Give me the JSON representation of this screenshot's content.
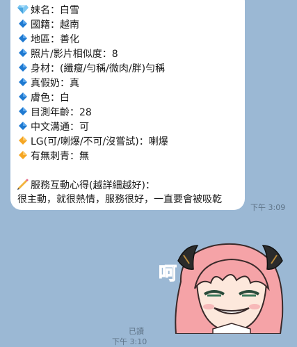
{
  "message": {
    "lines": [
      {
        "icon": "gem",
        "text": "妹名：白雪"
      },
      {
        "icon": "blue-diamond",
        "text": "國籍：越南"
      },
      {
        "icon": "blue-diamond",
        "text": "地區：善化"
      },
      {
        "icon": "blue-diamond",
        "text": "照片/影片相似度：8"
      },
      {
        "icon": "blue-diamond",
        "text": "身材：(纖瘦/勻稱/微肉/胖)勻稱"
      },
      {
        "icon": "blue-diamond",
        "text": "真假奶：真"
      },
      {
        "icon": "blue-diamond",
        "text": "膚色：白"
      },
      {
        "icon": "blue-diamond",
        "text": "目測年齡：28"
      },
      {
        "icon": "blue-diamond",
        "text": "中文溝通：可"
      },
      {
        "icon": "orange-diamond",
        "text": "LG(可/喇爆/不可/沒嘗試)：喇爆"
      },
      {
        "icon": "orange-diamond",
        "text": "有無刺青：無"
      },
      {
        "icon": "pencil",
        "text": "服務互動心得(越詳細越好)："
      },
      {
        "icon": "",
        "text": "很主動，就很熱情，服務很好，一直要會被吸乾"
      }
    ],
    "time": "下午 3:09"
  },
  "sticker": {
    "caption": "呵",
    "read_label": "已讀",
    "time": "下午 3:10"
  },
  "colors": {
    "background": "#9bb8d4",
    "bubble": "#ffffff",
    "blue_diamond": "#1f7ad1",
    "orange_diamond": "#f5a623"
  }
}
